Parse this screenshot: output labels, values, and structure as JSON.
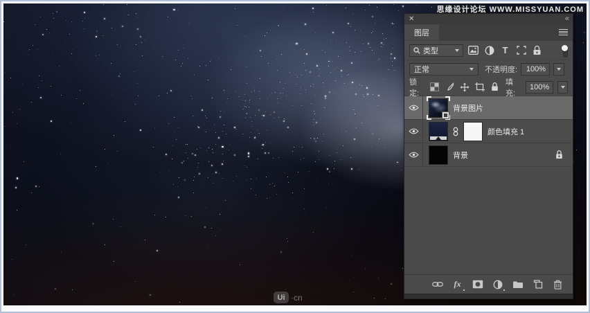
{
  "watermarks": {
    "top_right": "思缘设计论坛 WWW.MISSYUAN.COM",
    "bottom_logo": "Ui",
    "bottom_suffix": "·cn"
  },
  "panel": {
    "window": {
      "close_glyph": "✕",
      "collapse_glyph": "«"
    },
    "tab": "图层",
    "filter_bar": {
      "search_label": "类型",
      "type_filter_glyph": "T"
    },
    "blend_bar": {
      "mode": "正常",
      "opacity_label": "不透明度:",
      "opacity_value": "100%"
    },
    "lock_bar": {
      "label": "锁定:",
      "fill_label": "填充:",
      "fill_value": "100%"
    },
    "layers": [
      {
        "name": "背景图片",
        "kind": "smart-object",
        "selected": true,
        "visible": true
      },
      {
        "name": "颜色填充 1",
        "kind": "color-fill-with-mask",
        "selected": false,
        "visible": true
      },
      {
        "name": "背景",
        "kind": "background",
        "selected": false,
        "visible": true,
        "locked": true
      }
    ],
    "footer": {
      "fx_label": "fx"
    }
  },
  "colors": {
    "panel_bg": "#4a4a4a",
    "panel_titlebar": "#3a3a3a",
    "selected_row": "#6a6a6a",
    "frame_outer": "#b3c0dc",
    "frame_inner": "#f8fafb",
    "sky_top": "#111524",
    "sky_bottom_warm": "#0e0907",
    "fill_layer_color": "#141a30"
  }
}
